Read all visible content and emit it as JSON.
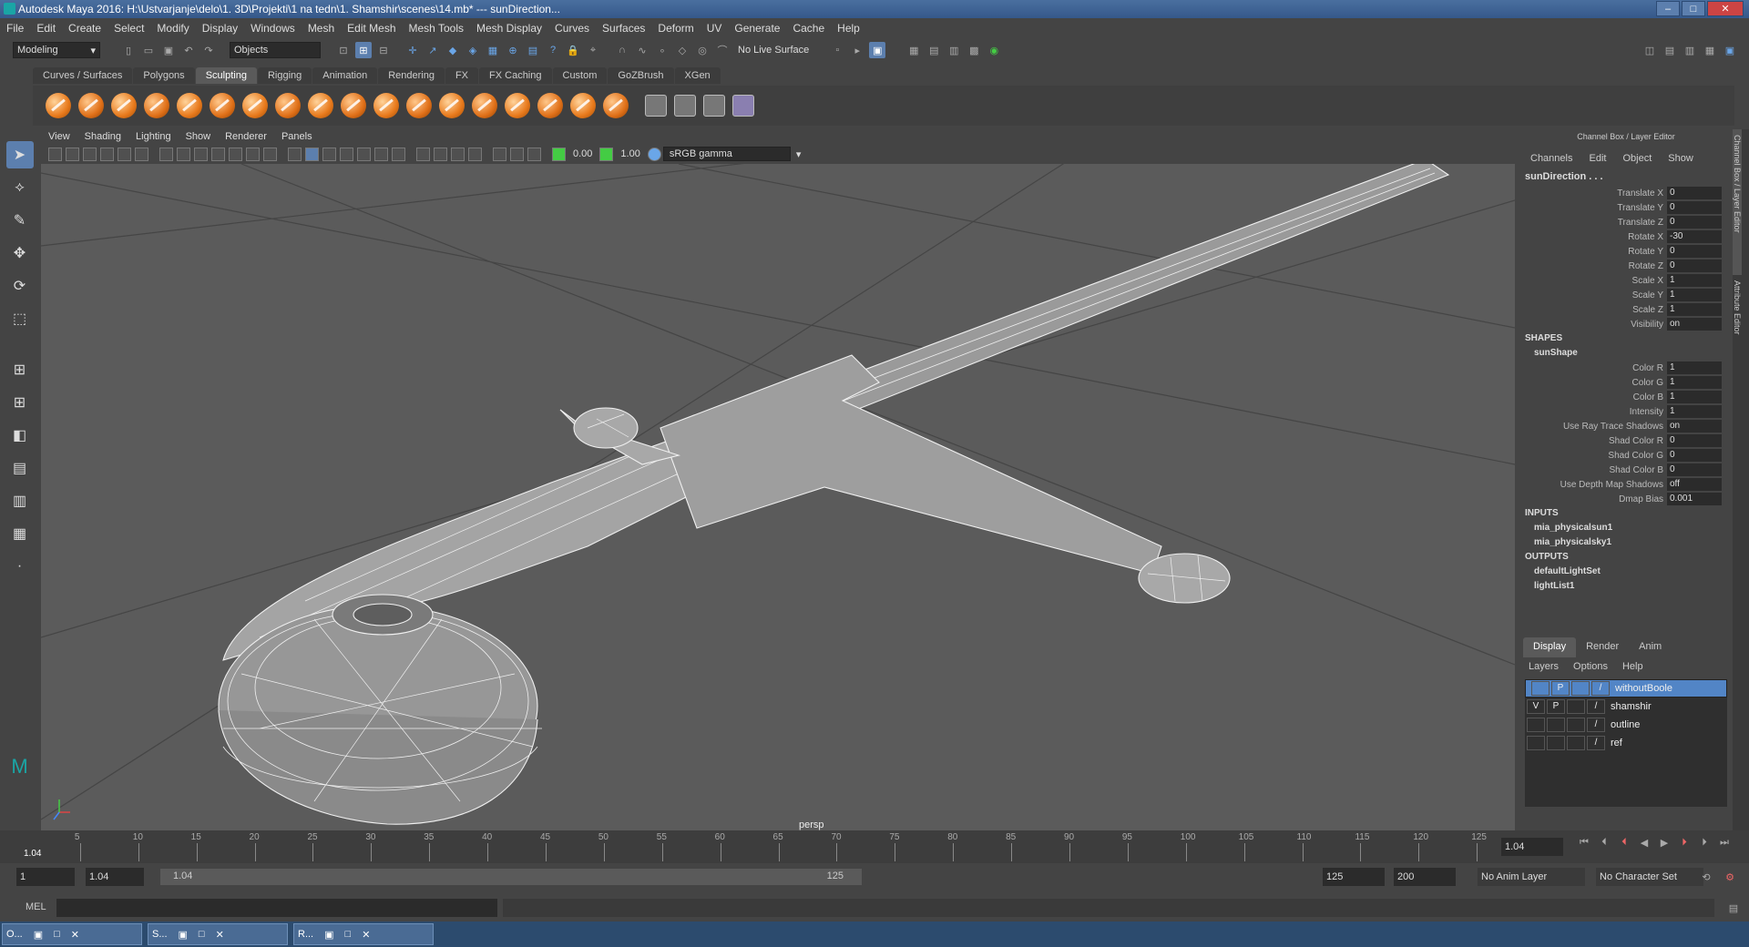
{
  "title": "Autodesk Maya 2016: H:\\Ustvarjanje\\delo\\1. 3D\\Projekti\\1 na tedn\\1. Shamshir\\scenes\\14.mb*   ---   sunDirection...",
  "window_buttons": [
    "–",
    "□",
    "✕"
  ],
  "menu": [
    "File",
    "Edit",
    "Create",
    "Select",
    "Modify",
    "Display",
    "Windows",
    "Mesh",
    "Edit Mesh",
    "Mesh Tools",
    "Mesh Display",
    "Curves",
    "Surfaces",
    "Deform",
    "UV",
    "Generate",
    "Cache",
    "Help"
  ],
  "status": {
    "mode": "Modeling",
    "objects": "Objects",
    "live_surface": "No Live Surface"
  },
  "shelf_tabs": [
    "Curves / Surfaces",
    "Polygons",
    "Sculpting",
    "Rigging",
    "Animation",
    "Rendering",
    "FX",
    "FX Caching",
    "Custom",
    "GoZBrush",
    "XGen"
  ],
  "active_shelf": "Sculpting",
  "panel_menu": [
    "View",
    "Shading",
    "Lighting",
    "Show",
    "Renderer",
    "Panels"
  ],
  "panel": {
    "exposure": "0.00",
    "gamma_val": "1.00",
    "colorspace": "sRGB gamma",
    "camera": "persp"
  },
  "channelbox": {
    "title": "Channel Box / Layer Editor",
    "menu": [
      "Channels",
      "Edit",
      "Object",
      "Show"
    ],
    "object": "sunDirection . . .",
    "transform": [
      {
        "name": "Translate X",
        "value": "0"
      },
      {
        "name": "Translate Y",
        "value": "0"
      },
      {
        "name": "Translate Z",
        "value": "0"
      },
      {
        "name": "Rotate X",
        "value": "-30"
      },
      {
        "name": "Rotate Y",
        "value": "0"
      },
      {
        "name": "Rotate Z",
        "value": "0"
      },
      {
        "name": "Scale X",
        "value": "1"
      },
      {
        "name": "Scale Y",
        "value": "1"
      },
      {
        "name": "Scale Z",
        "value": "1"
      },
      {
        "name": "Visibility",
        "value": "on"
      }
    ],
    "shapes_label": "SHAPES",
    "shape_name": "sunShape",
    "shape_attrs": [
      {
        "name": "Color R",
        "value": "1"
      },
      {
        "name": "Color G",
        "value": "1"
      },
      {
        "name": "Color B",
        "value": "1"
      },
      {
        "name": "Intensity",
        "value": "1"
      },
      {
        "name": "Use Ray Trace Shadows",
        "value": "on"
      },
      {
        "name": "Shad Color R",
        "value": "0"
      },
      {
        "name": "Shad Color G",
        "value": "0"
      },
      {
        "name": "Shad Color B",
        "value": "0"
      },
      {
        "name": "Use Depth Map Shadows",
        "value": "off"
      },
      {
        "name": "Dmap Bias",
        "value": "0.001"
      }
    ],
    "inputs_label": "INPUTS",
    "inputs": [
      "mia_physicalsun1",
      "mia_physicalsky1"
    ],
    "outputs_label": "OUTPUTS",
    "outputs": [
      "defaultLightSet",
      "lightList1"
    ]
  },
  "side_tabs": [
    "Channel Box / Layer Editor",
    "Attribute Editor"
  ],
  "layer_editor": {
    "tabs": [
      "Display",
      "Render",
      "Anim"
    ],
    "menu": [
      "Layers",
      "Options",
      "Help"
    ],
    "layers": [
      {
        "v": "",
        "p": "P",
        "name": "withoutBoole",
        "selected": true
      },
      {
        "v": "V",
        "p": "P",
        "name": "shamshir",
        "selected": false
      },
      {
        "v": "",
        "p": "",
        "name": "outline",
        "selected": false
      },
      {
        "v": "",
        "p": "",
        "name": "ref",
        "selected": false
      }
    ]
  },
  "timeline": {
    "ticks": [
      "5",
      "10",
      "15",
      "20",
      "25",
      "30",
      "35",
      "40",
      "45",
      "50",
      "55",
      "60",
      "65",
      "70",
      "75",
      "80",
      "85",
      "90",
      "95",
      "100",
      "105",
      "110",
      "115",
      "120",
      "125"
    ],
    "current": "1.04",
    "current_field": "1.04"
  },
  "range": {
    "start": "1",
    "start2": "1.04",
    "bar_start": "1.04",
    "bar_end": "125",
    "end": "125",
    "end2": "200",
    "anim_layer": "No Anim Layer",
    "char_set": "No Character Set"
  },
  "cmd": {
    "label": "MEL"
  },
  "taskbar": [
    "O...",
    "S...",
    "R..."
  ]
}
